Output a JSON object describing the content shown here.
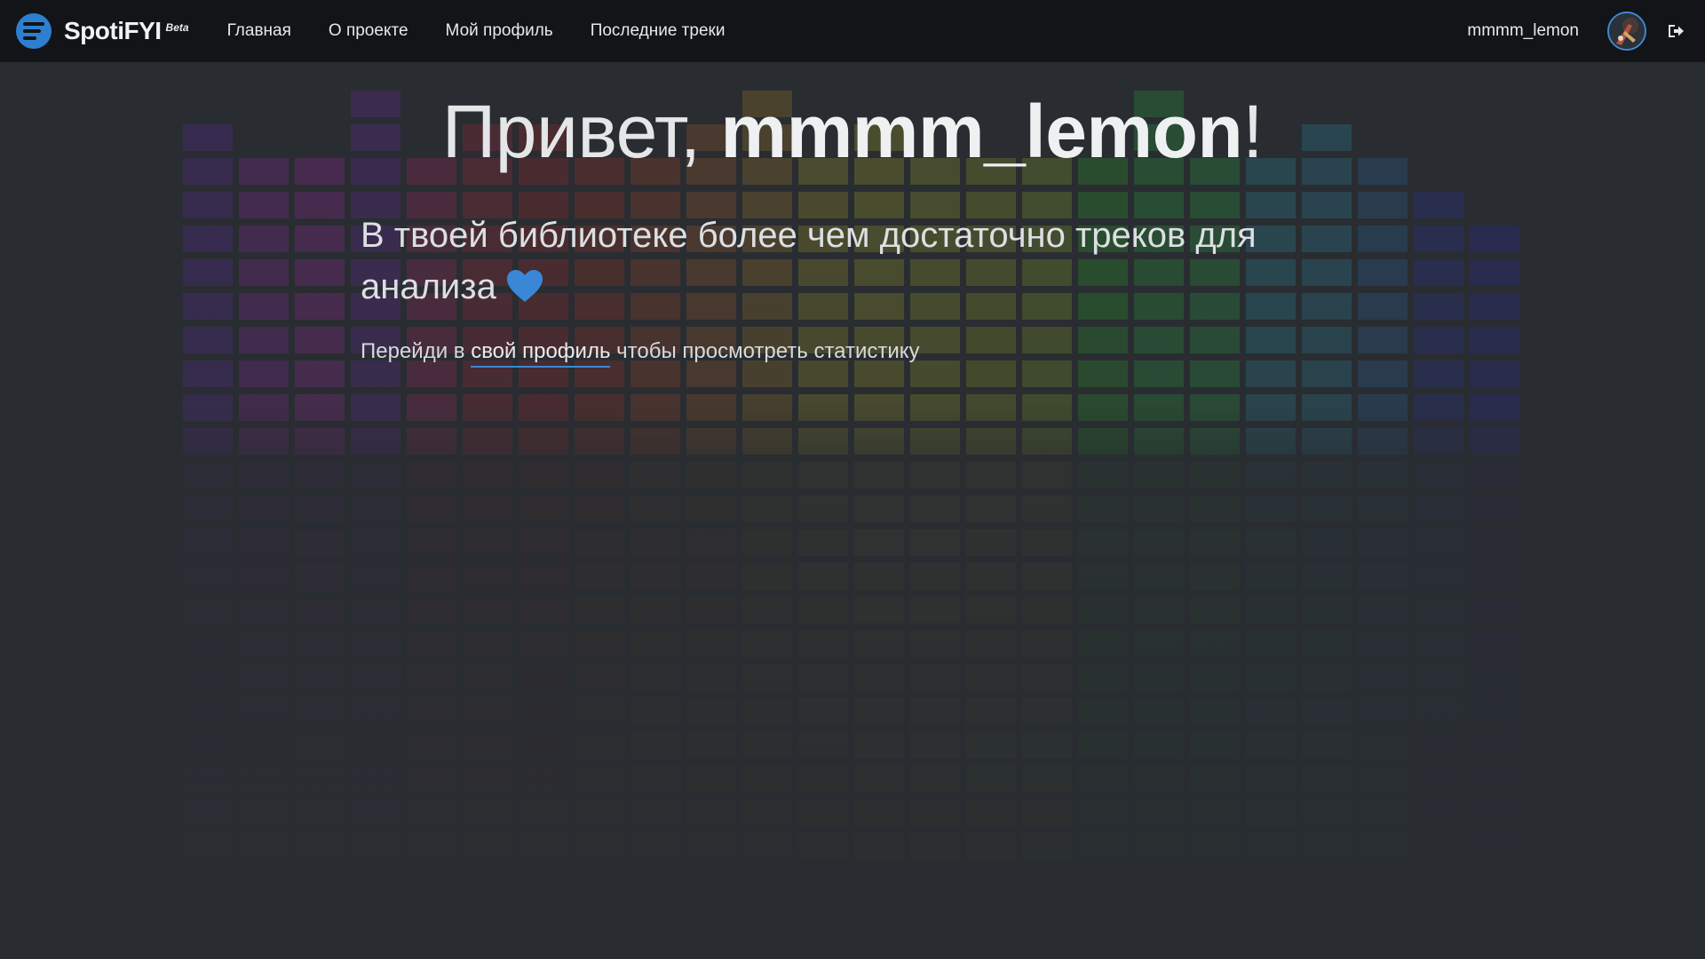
{
  "navbar": {
    "brand": {
      "name": "SpotiFYI",
      "badge": "Beta",
      "logo_icon": "spotify-list-logo"
    },
    "links": [
      {
        "label": "Главная"
      },
      {
        "label": "О проекте"
      },
      {
        "label": "Мой профиль"
      },
      {
        "label": "Последние треки"
      }
    ],
    "username": "mmmm_lemon",
    "avatar_icon": "user-avatar",
    "logout_icon": "sign-out-icon"
  },
  "main": {
    "greeting_prefix": "Привет, ",
    "greeting_name": "mmmm_lemon",
    "greeting_suffix": "!",
    "subtitle": "В твоей библиотеке более чем достаточно треков для анализа",
    "subtitle_icon": "heart-icon",
    "hint_before": "Перейди в ",
    "hint_link": "свой профиль",
    "hint_after": " чтобы просмотреть статистику"
  },
  "colors": {
    "accent": "#2f7fd0",
    "navbar_bg": "#121417",
    "page_bg": "#292d31",
    "heart": "#3a87d8"
  }
}
